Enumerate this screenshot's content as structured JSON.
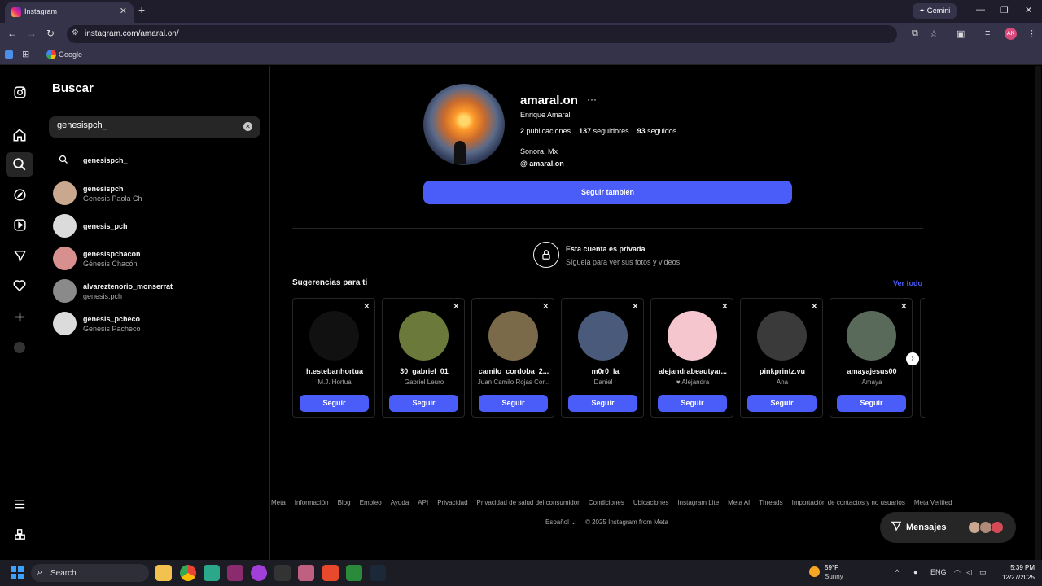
{
  "browser": {
    "tab_title": "Instagram",
    "tab_close": "✕",
    "new_tab": "+",
    "gemini_label": "✦ Gemini",
    "url": "instagram.com/amaral.on/",
    "profile_initials": "AK",
    "bookmark_google": "Google"
  },
  "sidebar": {
    "icons": [
      "instagram-icon",
      "home-icon",
      "search-icon",
      "explore-icon",
      "reels-icon",
      "messages-icon",
      "notifications-icon",
      "create-icon",
      "profile-icon",
      "menu-icon",
      "more-icon"
    ]
  },
  "search": {
    "title": "Buscar",
    "query": "genesispch_",
    "query_suggestion": "genesispch_",
    "results": [
      {
        "username": "genesispch",
        "fullname": "Genesis Paola Ch"
      },
      {
        "username": "genesis_pch",
        "fullname": ""
      },
      {
        "username": "genesispchacon",
        "fullname": "Génesis Chacón"
      },
      {
        "username": "alvareztenorio_monserrat",
        "fullname": "genesis.pch"
      },
      {
        "username": "genesis_pcheco",
        "fullname": "Genesis Pacheco"
      }
    ]
  },
  "profile": {
    "username": "amaral.on",
    "more": "···",
    "full_name": "Enrique Amaral",
    "posts_count": "2",
    "posts_label": " publicaciones",
    "followers_count": "137",
    "followers_label": " seguidores",
    "following_count": "93",
    "following_label": " seguidos",
    "location": "Sonora, Mx",
    "threads": "@ amaral.on",
    "follow_back_label": "Seguir también",
    "private_title": "Esta cuenta es privada",
    "private_sub": "Síguela para ver sus fotos y videos."
  },
  "suggestions": {
    "title": "Sugerencias para ti",
    "see_all": "Ver todo",
    "follow_label": "Seguir",
    "items": [
      {
        "username": "h.estebanhortua",
        "fullname": "M.J. Hortua",
        "color": "#111111"
      },
      {
        "username": "30_gabriel_01",
        "fullname": "Gabriel Leuro",
        "color": "#6b7a3a"
      },
      {
        "username": "camilo_cordoba_2...",
        "fullname": "Juan Camilo Rojas Cor...",
        "color": "#7a6a4a"
      },
      {
        "username": "_m0r0_la",
        "fullname": "Daniel",
        "color": "#4a5a7a"
      },
      {
        "username": "alejandrabeautyar...",
        "fullname": "♥ Alejandra",
        "color": "#f6c6cf"
      },
      {
        "username": "pinkprintz.vu",
        "fullname": "Ana",
        "color": "#3a3a3a"
      },
      {
        "username": "amayajesus00",
        "fullname": "Amaya",
        "color": "#5a6a5a"
      }
    ]
  },
  "footer": {
    "links": [
      "Meta",
      "Información",
      "Blog",
      "Empleo",
      "Ayuda",
      "API",
      "Privacidad",
      "Privacidad de salud del consumidor",
      "Condiciones",
      "Ubicaciones",
      "Instagram Lite",
      "Meta AI",
      "Threads",
      "Importación de contactos y no usuarios",
      "Meta Verified"
    ],
    "language": "Español ⌄",
    "copyright": "© 2025 Instagram from Meta"
  },
  "messages_label": "Mensajes",
  "taskbar": {
    "search_label": "Search",
    "weather_temp": "59°F",
    "weather_desc": "Sunny",
    "lang": "ENG",
    "time": "5:39 PM",
    "date": "12/27/2025"
  }
}
